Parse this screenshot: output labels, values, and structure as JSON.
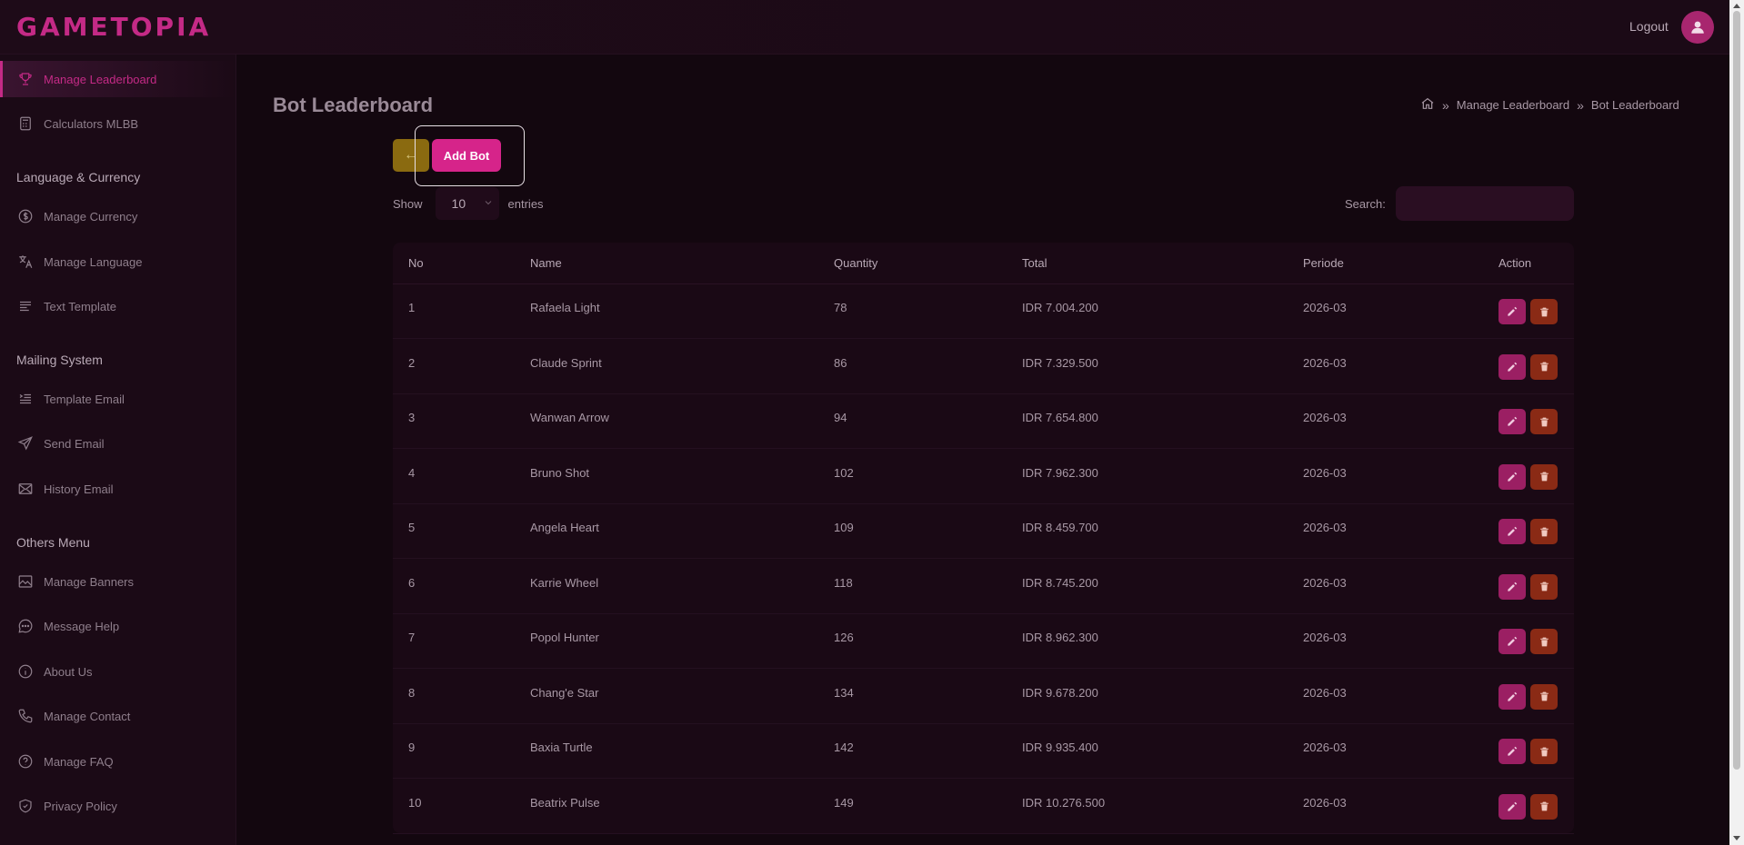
{
  "header": {
    "logo": "GAMETOPIA",
    "logout_label": "Logout"
  },
  "sidebar": {
    "items": [
      {
        "label": "Manage Leaderboard",
        "icon": "trophy-icon",
        "active": true
      },
      {
        "label": "Calculators MLBB",
        "icon": "calculator-icon"
      },
      {
        "label": "Manage Currency",
        "icon": "dollar-icon"
      },
      {
        "label": "Manage Language",
        "icon": "translate-icon"
      },
      {
        "label": "Text Template",
        "icon": "text-lines-icon"
      },
      {
        "label": "Template Email",
        "icon": "list-indent-icon"
      },
      {
        "label": "Send Email",
        "icon": "send-icon"
      },
      {
        "label": "History Email",
        "icon": "envelope-icon"
      },
      {
        "label": "Manage Banners",
        "icon": "image-icon"
      },
      {
        "label": "Message Help",
        "icon": "chat-icon"
      },
      {
        "label": "About Us",
        "icon": "info-icon"
      },
      {
        "label": "Manage Contact",
        "icon": "phone-icon"
      },
      {
        "label": "Manage FAQ",
        "icon": "question-icon"
      },
      {
        "label": "Privacy Policy",
        "icon": "shield-icon"
      }
    ],
    "sections": {
      "language_currency": "Language & Currency",
      "mailing_system": "Mailing System",
      "others_menu": "Others Menu"
    }
  },
  "main": {
    "title": "Bot Leaderboard",
    "breadcrumb": [
      "Manage Leaderboard",
      "Bot Leaderboard"
    ],
    "add_button": "Add Bot",
    "show_label": "Show",
    "entries_value": "10",
    "entries_label": "entries",
    "search_label": "Search:",
    "search_value": ""
  },
  "table": {
    "columns": [
      "No",
      "Name",
      "Quantity",
      "Total",
      "Periode",
      "Action"
    ],
    "rows": [
      [
        "1",
        "Rafaela Light",
        "78",
        "IDR 7.004.200",
        "2026-03"
      ],
      [
        "2",
        "Claude Sprint",
        "86",
        "IDR 7.329.500",
        "2026-03"
      ],
      [
        "3",
        "Wanwan Arrow",
        "94",
        "IDR 7.654.800",
        "2026-03"
      ],
      [
        "4",
        "Bruno Shot",
        "102",
        "IDR 7.962.300",
        "2026-03"
      ],
      [
        "5",
        "Angela Heart",
        "109",
        "IDR 8.459.700",
        "2026-03"
      ],
      [
        "6",
        "Karrie Wheel",
        "118",
        "IDR 8.745.200",
        "2026-03"
      ],
      [
        "7",
        "Popol Hunter",
        "126",
        "IDR 8.962.300",
        "2026-03"
      ],
      [
        "8",
        "Chang'e Star",
        "134",
        "IDR 9.678.200",
        "2026-03"
      ],
      [
        "9",
        "Baxia Turtle",
        "142",
        "IDR 9.935.400",
        "2026-03"
      ],
      [
        "10",
        "Beatrix Pulse",
        "149",
        "IDR 10.276.500",
        "2026-03"
      ]
    ]
  },
  "colors": {
    "accent": "#d6248a",
    "edit_button": "#9b1f63",
    "delete_button": "#8a2a15",
    "back_button": "#8a6a10"
  }
}
